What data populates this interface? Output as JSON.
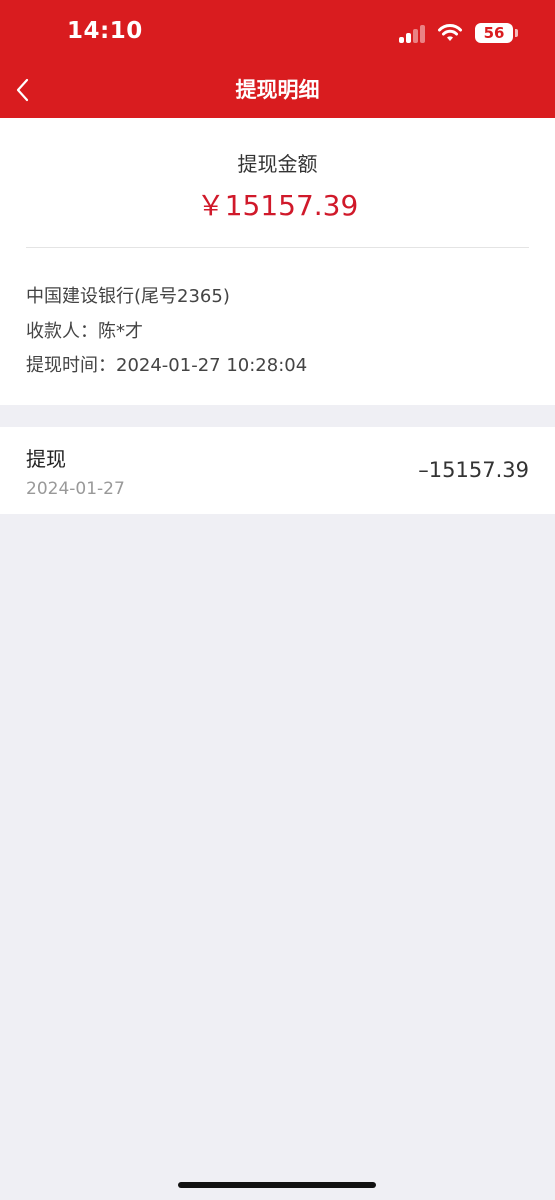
{
  "status_bar": {
    "time": "14:10",
    "battery": "56"
  },
  "nav": {
    "title": "提现明细"
  },
  "summary": {
    "amount_label": "提现金额",
    "amount": "￥15157.39",
    "bank": "中国建设银行(尾号2365)",
    "payee": "收款人：陈*才",
    "time": "提现时间：2024-01-27 10:28:04"
  },
  "transaction": {
    "title": "提现",
    "date": "2024-01-27",
    "amount": "–15157.39"
  },
  "colors": {
    "brand_red": "#d91c1f",
    "amount_red": "#d0192a",
    "background": "#efeff4"
  }
}
